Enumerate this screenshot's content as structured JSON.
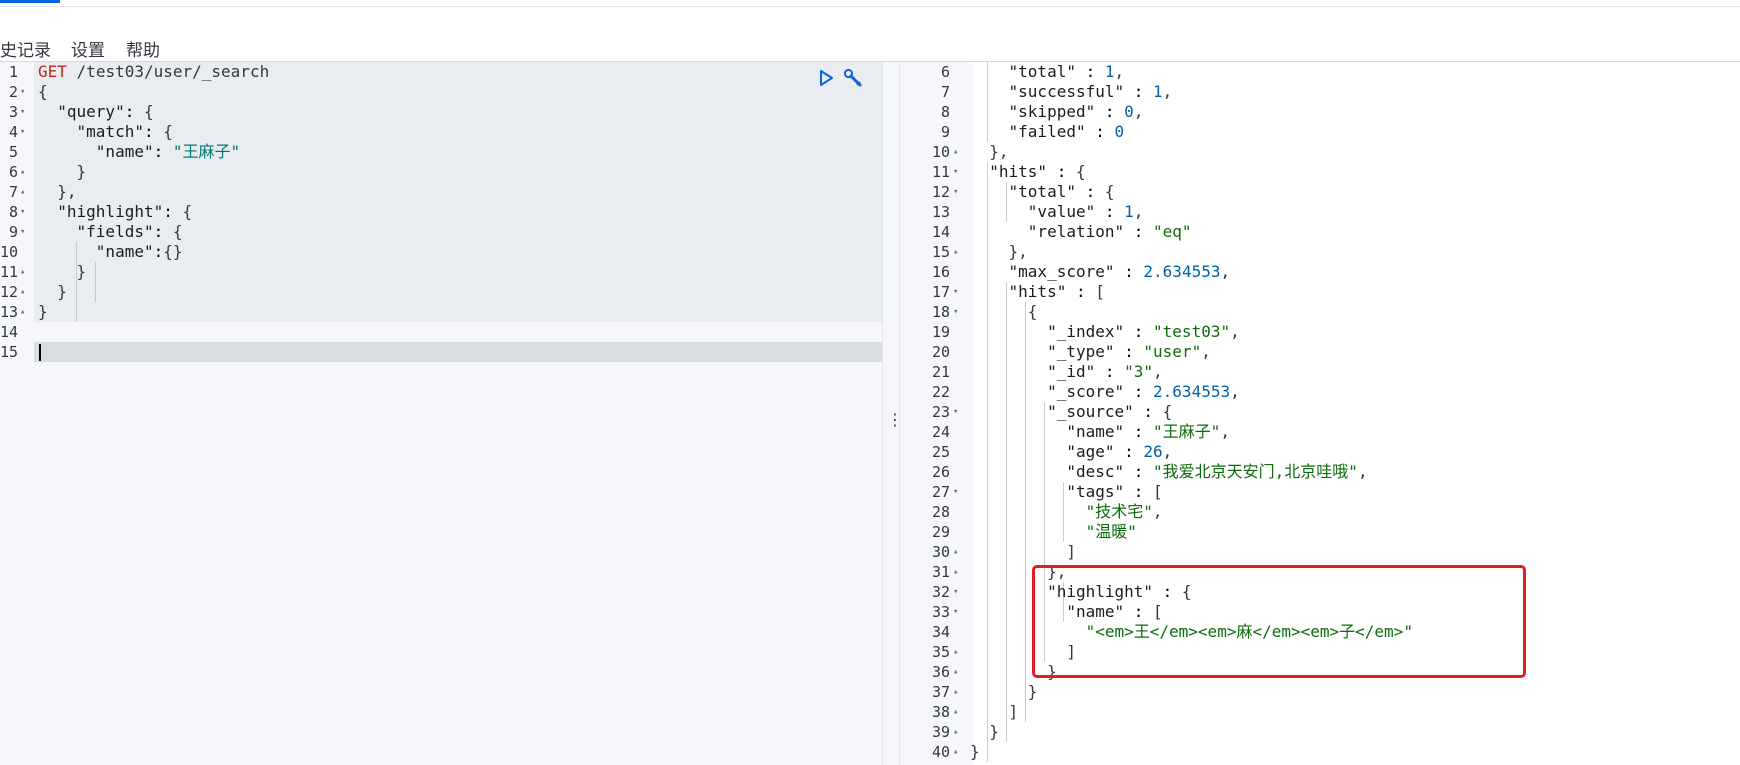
{
  "menu": {
    "history_label": "史记录",
    "settings_label": "设置",
    "help_label": "帮助"
  },
  "request": {
    "lines": [
      {
        "n": "1",
        "fold": "",
        "code": "GET /test03/user/_search"
      },
      {
        "n": "2",
        "fold": "▾",
        "code": "{"
      },
      {
        "n": "3",
        "fold": "▾",
        "code": "  \"query\": {"
      },
      {
        "n": "4",
        "fold": "▾",
        "code": "    \"match\": {"
      },
      {
        "n": "5",
        "fold": "",
        "code": "      \"name\": \"王麻子\""
      },
      {
        "n": "6",
        "fold": "▴",
        "code": "    }"
      },
      {
        "n": "7",
        "fold": "▴",
        "code": "  },"
      },
      {
        "n": "8",
        "fold": "▾",
        "code": "  \"highlight\": {"
      },
      {
        "n": "9",
        "fold": "▾",
        "code": "    \"fields\": {"
      },
      {
        "n": "10",
        "fold": "",
        "code": "      \"name\":{}"
      },
      {
        "n": "11",
        "fold": "▴",
        "code": "    }"
      },
      {
        "n": "12",
        "fold": "▴",
        "code": "  }"
      },
      {
        "n": "13",
        "fold": "▴",
        "code": "}"
      },
      {
        "n": "14",
        "fold": "",
        "code": ""
      },
      {
        "n": "15",
        "fold": "",
        "code": ""
      }
    ]
  },
  "response": {
    "lines": [
      {
        "n": "6",
        "fold": "",
        "code": "    \"total\" : 1,"
      },
      {
        "n": "7",
        "fold": "",
        "code": "    \"successful\" : 1,"
      },
      {
        "n": "8",
        "fold": "",
        "code": "    \"skipped\" : 0,"
      },
      {
        "n": "9",
        "fold": "",
        "code": "    \"failed\" : 0"
      },
      {
        "n": "10",
        "fold": "▴",
        "code": "  },"
      },
      {
        "n": "11",
        "fold": "▾",
        "code": "  \"hits\" : {"
      },
      {
        "n": "12",
        "fold": "▾",
        "code": "    \"total\" : {"
      },
      {
        "n": "13",
        "fold": "",
        "code": "      \"value\" : 1,"
      },
      {
        "n": "14",
        "fold": "",
        "code": "      \"relation\" : \"eq\""
      },
      {
        "n": "15",
        "fold": "▴",
        "code": "    },"
      },
      {
        "n": "16",
        "fold": "",
        "code": "    \"max_score\" : 2.634553,"
      },
      {
        "n": "17",
        "fold": "▾",
        "code": "    \"hits\" : ["
      },
      {
        "n": "18",
        "fold": "▾",
        "code": "      {"
      },
      {
        "n": "19",
        "fold": "",
        "code": "        \"_index\" : \"test03\","
      },
      {
        "n": "20",
        "fold": "",
        "code": "        \"_type\" : \"user\","
      },
      {
        "n": "21",
        "fold": "",
        "code": "        \"_id\" : \"3\","
      },
      {
        "n": "22",
        "fold": "",
        "code": "        \"_score\" : 2.634553,"
      },
      {
        "n": "23",
        "fold": "▾",
        "code": "        \"_source\" : {"
      },
      {
        "n": "24",
        "fold": "",
        "code": "          \"name\" : \"王麻子\","
      },
      {
        "n": "25",
        "fold": "",
        "code": "          \"age\" : 26,"
      },
      {
        "n": "26",
        "fold": "",
        "code": "          \"desc\" : \"我爱北京天安门,北京哇哦\","
      },
      {
        "n": "27",
        "fold": "▾",
        "code": "          \"tags\" : ["
      },
      {
        "n": "28",
        "fold": "",
        "code": "            \"技术宅\","
      },
      {
        "n": "29",
        "fold": "",
        "code": "            \"温暖\""
      },
      {
        "n": "30",
        "fold": "▴",
        "code": "          ]"
      },
      {
        "n": "31",
        "fold": "▴",
        "code": "        },"
      },
      {
        "n": "32",
        "fold": "▾",
        "code": "        \"highlight\" : {"
      },
      {
        "n": "33",
        "fold": "▾",
        "code": "          \"name\" : ["
      },
      {
        "n": "34",
        "fold": "",
        "code": "            \"<em>王</em><em>麻</em><em>子</em>\""
      },
      {
        "n": "35",
        "fold": "▴",
        "code": "          ]"
      },
      {
        "n": "36",
        "fold": "▴",
        "code": "        }"
      },
      {
        "n": "37",
        "fold": "▴",
        "code": "      }"
      },
      {
        "n": "38",
        "fold": "▴",
        "code": "    ]"
      },
      {
        "n": "39",
        "fold": "▴",
        "code": "  }"
      },
      {
        "n": "40",
        "fold": "▴",
        "code": "}"
      }
    ]
  },
  "colors": {
    "accent": "#0b64dd",
    "annotation_box": "#e0201f",
    "string_request": "#007871",
    "string_response": "#0d6b0d",
    "number": "#0061a6",
    "method": "#bd271e"
  },
  "icons": {
    "run": "play-icon",
    "settings": "wrench-icon",
    "resize": "vertical-ellipsis-icon"
  }
}
